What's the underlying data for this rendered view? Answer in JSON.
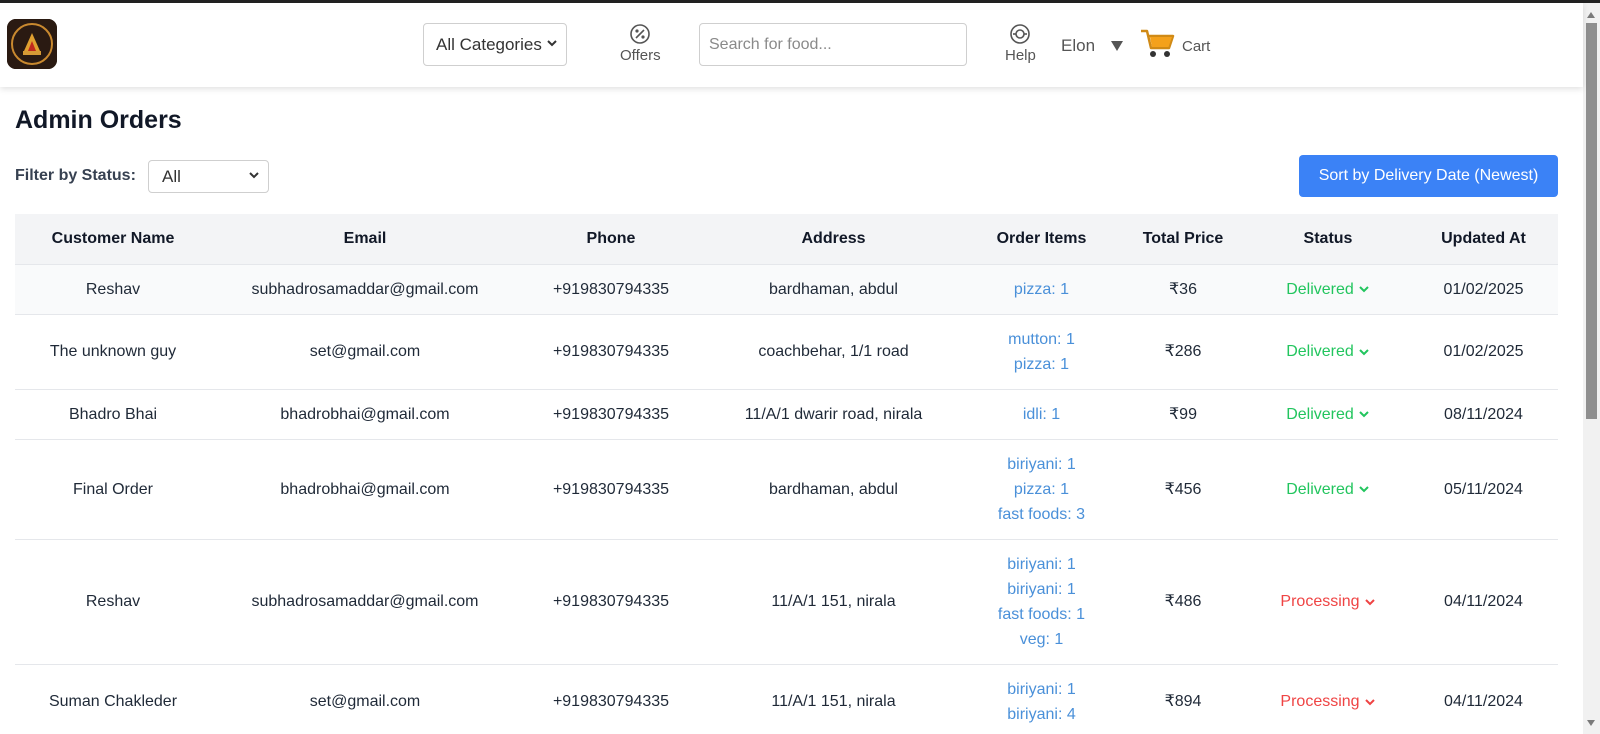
{
  "header": {
    "categories": {
      "selected": "All Categories"
    },
    "offers_label": "Offers",
    "search_placeholder": "Search for food...",
    "help_label": "Help",
    "user_name": "Elon",
    "cart_label": "Cart"
  },
  "main": {
    "title": "Admin Orders",
    "filter_label": "Filter by Status:",
    "filter_value": "All",
    "sort_button": "Sort by Delivery Date (Newest)",
    "columns": [
      "Customer Name",
      "Email",
      "Phone",
      "Address",
      "Order Items",
      "Total Price",
      "Status",
      "Updated At"
    ],
    "rows": [
      {
        "name": "Reshav",
        "email": "subhadrosamaddar@gmail.com",
        "phone": "+919830794335",
        "address": "bardhaman, abdul",
        "items": [
          "pizza: 1"
        ],
        "total": "₹36",
        "status": "Delivered",
        "updated": "01/02/2025"
      },
      {
        "name": "The unknown guy",
        "email": "set@gmail.com",
        "phone": "+919830794335",
        "address": "coachbehar, 1/1 road",
        "items": [
          "mutton: 1",
          "pizza: 1"
        ],
        "total": "₹286",
        "status": "Delivered",
        "updated": "01/02/2025"
      },
      {
        "name": "Bhadro Bhai",
        "email": "bhadrobhai@gmail.com",
        "phone": "+919830794335",
        "address": "11/A/1 dwarir road, nirala",
        "items": [
          "idli: 1"
        ],
        "total": "₹99",
        "status": "Delivered",
        "updated": "08/11/2024"
      },
      {
        "name": "Final Order",
        "email": "bhadrobhai@gmail.com",
        "phone": "+919830794335",
        "address": "bardhaman, abdul",
        "items": [
          "biriyani: 1",
          "pizza: 1",
          "fast foods: 3"
        ],
        "total": "₹456",
        "status": "Delivered",
        "updated": "05/11/2024"
      },
      {
        "name": "Reshav",
        "email": "subhadrosamaddar@gmail.com",
        "phone": "+919830794335",
        "address": "11/A/1 151, nirala",
        "items": [
          "biriyani: 1",
          "biriyani: 1",
          "fast foods: 1",
          "veg: 1"
        ],
        "total": "₹486",
        "status": "Processing",
        "updated": "04/11/2024"
      },
      {
        "name": "Suman Chakleder",
        "email": "set@gmail.com",
        "phone": "+919830794335",
        "address": "11/A/1 151, nirala",
        "items": [
          "biriyani: 1",
          "biriyani: 4"
        ],
        "total": "₹894",
        "status": "Processing",
        "updated": "04/11/2024"
      }
    ]
  },
  "colors": {
    "accent": "#3b82f6",
    "delivered": "#22c55e",
    "processing": "#ef4444",
    "item_link": "#4a90d9"
  }
}
